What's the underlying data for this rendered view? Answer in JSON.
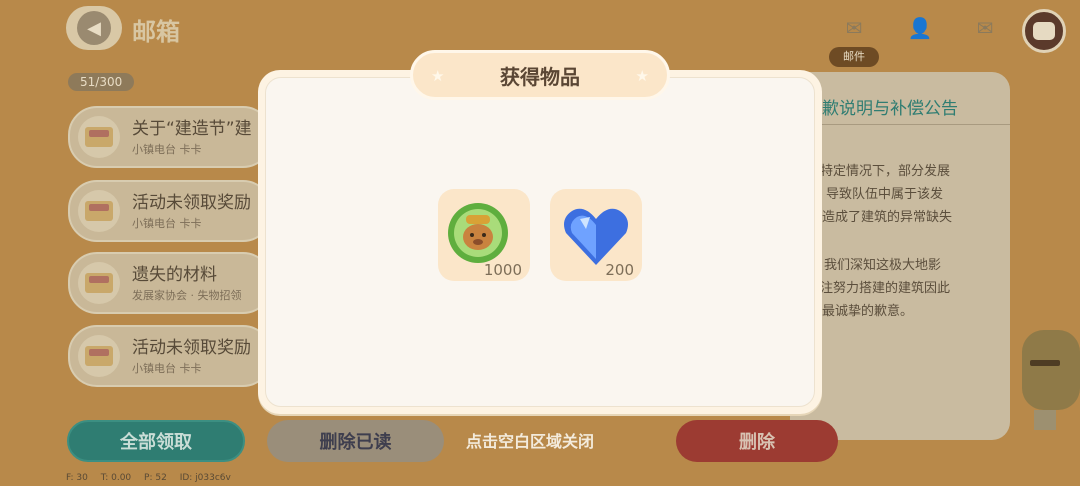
{
  "header": {
    "title": "邮箱",
    "mail_count": "51/300"
  },
  "mail_list": [
    {
      "title": "关于“建造节”建",
      "sender": "小镇电台 卡卡"
    },
    {
      "title": "活动未领取奖励",
      "sender": "小镇电台 卡卡"
    },
    {
      "title": "遗失的材料",
      "sender": "发展家协会 · 失物招领"
    },
    {
      "title": "活动未领取奖励",
      "sender": "小镇电台 卡卡"
    }
  ],
  "tabs": {
    "active_label": "邮件"
  },
  "detail": {
    "title": "歉说明与补偿公告",
    "lines": [
      "特定情况下，部分发展",
      "导致队伍中属于该发",
      "造成了建筑的异常缺失",
      "我们深知这极大地影",
      "注努力搭建的建筑因此",
      "最诚挚的歉意。"
    ]
  },
  "buttons": {
    "claim_all": "全部领取",
    "delete_read": "删除已读",
    "delete": "删除"
  },
  "modal": {
    "title": "获得物品",
    "items": [
      {
        "icon": "beaver-coin-icon",
        "count": "1000"
      },
      {
        "icon": "blue-heart-gem-icon",
        "count": "200"
      }
    ],
    "close_hint": "点击空白区域关闭"
  },
  "debug": {
    "f": "F: 30",
    "t": "T: 0.00",
    "p": "P: 52",
    "id": "ID: j033c6v"
  },
  "colors": {
    "accent_green": "#2f7d72",
    "delete_red": "#9c3b32",
    "modal_bg": "#faf6f0"
  }
}
